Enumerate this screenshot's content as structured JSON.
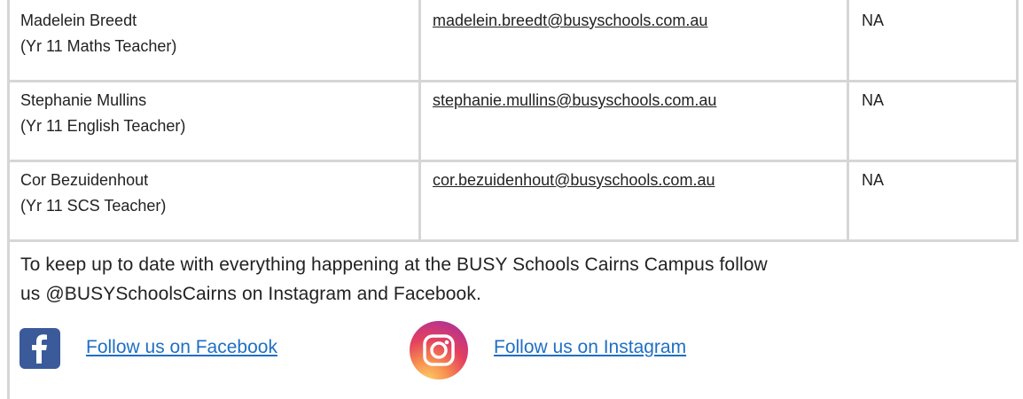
{
  "contacts": [
    {
      "name": "Madelein Breedt",
      "role": "(Yr 11 Maths Teacher)",
      "email": "madelein.breedt@busyschools.com.au",
      "phone": "NA"
    },
    {
      "name": "Stephanie Mullins",
      "role": "(Yr 11 English Teacher)",
      "email": "stephanie.mullins@busyschools.com.au",
      "phone": "NA"
    },
    {
      "name": "Cor Bezuidenhout",
      "role": "(Yr 11 SCS Teacher)",
      "email": "cor.bezuidenhout@busyschools.com.au",
      "phone": "NA"
    }
  ],
  "follow": {
    "line1": "To keep up to date with everything happening at the BUSY Schools Cairns Campus follow",
    "line2": "us @BUSYSchoolsCairns on Instagram and Facebook."
  },
  "social": {
    "facebook_label": "Follow us on Facebook",
    "instagram_label": "Follow us on Instagram",
    "facebook_icon": "facebook-icon",
    "instagram_icon": "instagram-icon",
    "facebook_color": "#3b5a9a",
    "link_color": "#1f6fc4"
  }
}
